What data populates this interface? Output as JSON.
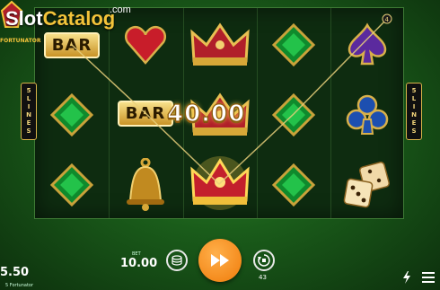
{
  "watermark": {
    "brand_part1": "Slot",
    "brand_part2": "Catalog",
    "suffix": ".com"
  },
  "game": {
    "logo_text": "FORTUNATOR",
    "name": "5 Fortunator"
  },
  "reels": {
    "columns": [
      [
        "bar",
        "emerald",
        "emerald"
      ],
      [
        "heart",
        "bar",
        "bell"
      ],
      [
        "crown",
        "crown",
        "crown"
      ],
      [
        "emerald",
        "emerald",
        "emerald"
      ],
      [
        "spade",
        "club",
        "dice"
      ]
    ],
    "bar_label": "BAR"
  },
  "lines": {
    "left_tab": [
      "5",
      "L",
      "I",
      "N",
      "E",
      "S"
    ],
    "right_tab": [
      "5",
      "L",
      "I",
      "N",
      "E",
      "S"
    ],
    "payline_marker": "4"
  },
  "win": {
    "amount": "40.00"
  },
  "footer": {
    "balance": "5.50",
    "bet_label": "BET",
    "bet_value": "10.00",
    "autoplay_count": "43"
  },
  "colors": {
    "accent": "#f3c43a",
    "spin": "#f07b0a",
    "reel_bg": "#0e2c10",
    "felt": "#2f8a2a"
  },
  "icons": [
    "coin-stack-icon",
    "fast-forward-icon",
    "autoplay-icon",
    "lightning-icon",
    "menu-icon"
  ]
}
